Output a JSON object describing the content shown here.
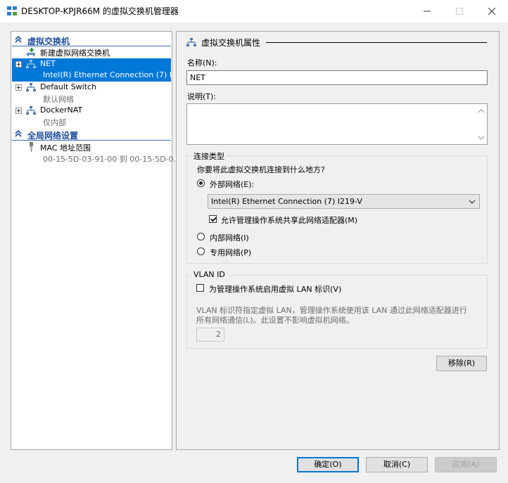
{
  "window": {
    "title": "DESKTOP-KPJR66M 的虚拟交换机管理器"
  },
  "tree": {
    "section_switches": "虚拟交换机",
    "new_switch": "新建虚拟网络交换机",
    "switches": [
      {
        "name": "NET",
        "detail": "Intel(R) Ethernet Connection (7) I..."
      },
      {
        "name": "Default Switch",
        "detail": "默认网络"
      },
      {
        "name": "DockerNAT",
        "detail": "仅内部"
      }
    ],
    "section_global": "全局网络设置",
    "mac": {
      "name": "MAC 地址范围",
      "detail": "00-15-5D-03-91-00 到 00-15-5D-0..."
    }
  },
  "props": {
    "title": "虚拟交换机属性",
    "name_label": "名称(N):",
    "name_value": "NET",
    "desc_label": "说明(T):",
    "conn_group": "连接类型",
    "conn_question": "你要将此虚拟交换机连接到什么地方?",
    "external": "外部网络(E):",
    "adapter": "Intel(R) Ethernet Connection (7) I219-V",
    "allow_share": "允许管理操作系统共享此网络适配器(M)",
    "internal": "内部网络(I)",
    "private": "专用网络(P)",
    "vlan_group": "VLAN ID",
    "vlan_enable": "为管理操作系统启用虚拟 LAN 标识(V)",
    "vlan_desc_1": "VLAN 标识符指定虚拟 LAN，管理操作系统使用该 LAN 通过此网络适配器进行",
    "vlan_desc_2": "所有网络通信(L)。此设置不影响虚拟机网络。",
    "vlan_value": "2",
    "remove": "移除(R)"
  },
  "buttons": {
    "ok": "确定(O)",
    "cancel": "取消(C)",
    "apply": "应用(A)"
  },
  "colors": {
    "accent": "#0078d7",
    "section": "#1f4e9c"
  }
}
